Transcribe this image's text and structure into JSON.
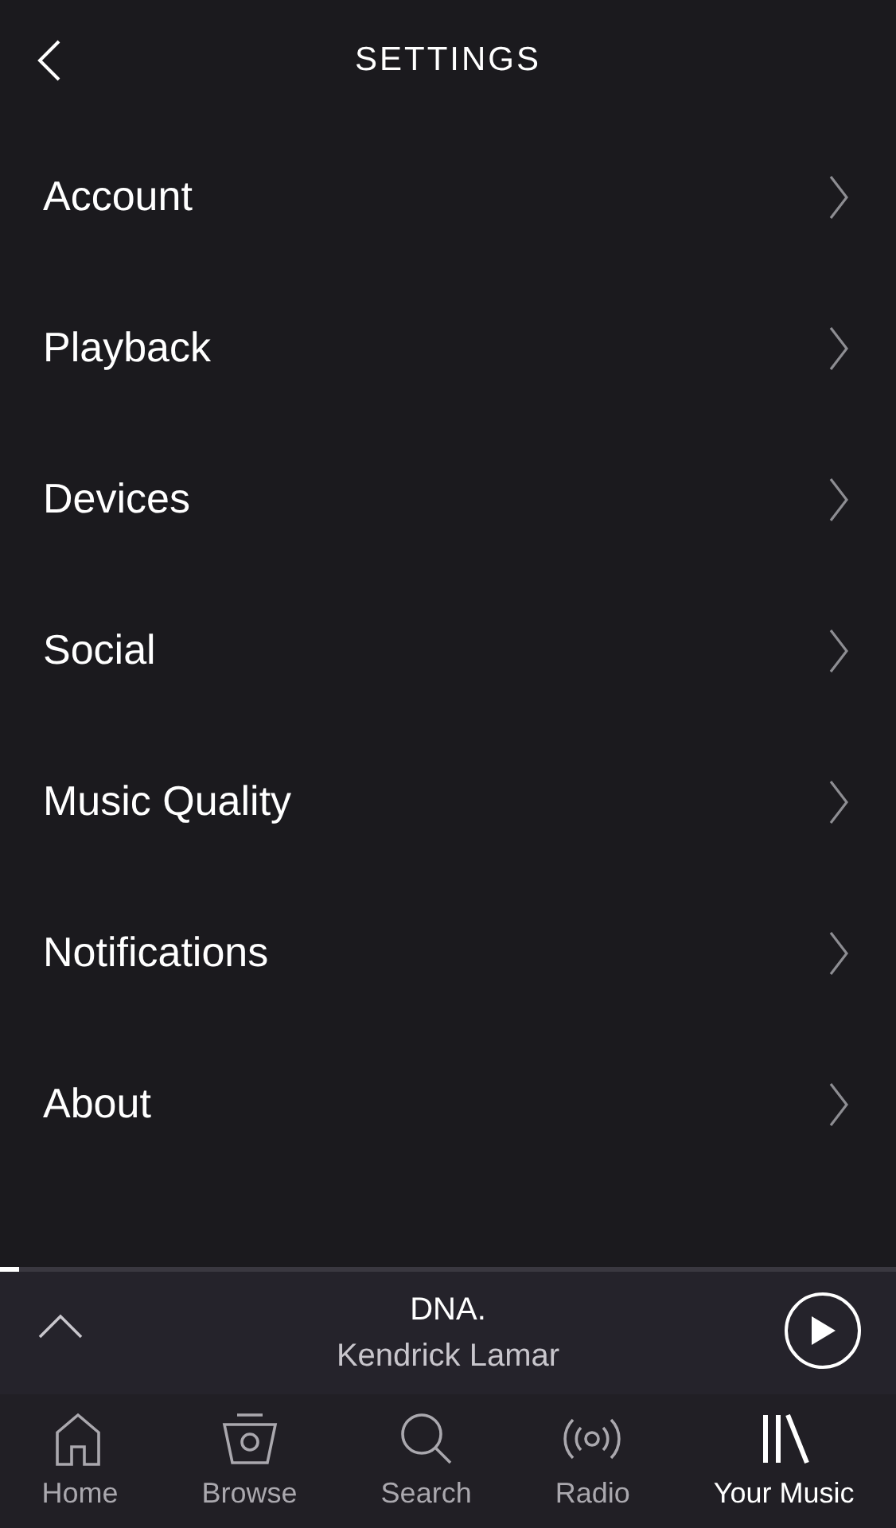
{
  "header": {
    "title": "SETTINGS"
  },
  "menu": [
    {
      "label": "Account"
    },
    {
      "label": "Playback"
    },
    {
      "label": "Devices"
    },
    {
      "label": "Social"
    },
    {
      "label": "Music Quality"
    },
    {
      "label": "Notifications"
    },
    {
      "label": "About"
    }
  ],
  "now_playing": {
    "level": 0.022,
    "title": "DNA.",
    "artist": "Kendrick Lamar",
    "playing": false
  },
  "tabs": [
    {
      "label": "Home",
      "kind": "home",
      "selected": false
    },
    {
      "label": "Browse",
      "kind": "browse",
      "selected": false
    },
    {
      "label": "Search",
      "kind": "search",
      "selected": false
    },
    {
      "label": "Radio",
      "kind": "radio",
      "selected": false
    },
    {
      "label": "Your Music",
      "kind": "library",
      "selected": true
    }
  ]
}
